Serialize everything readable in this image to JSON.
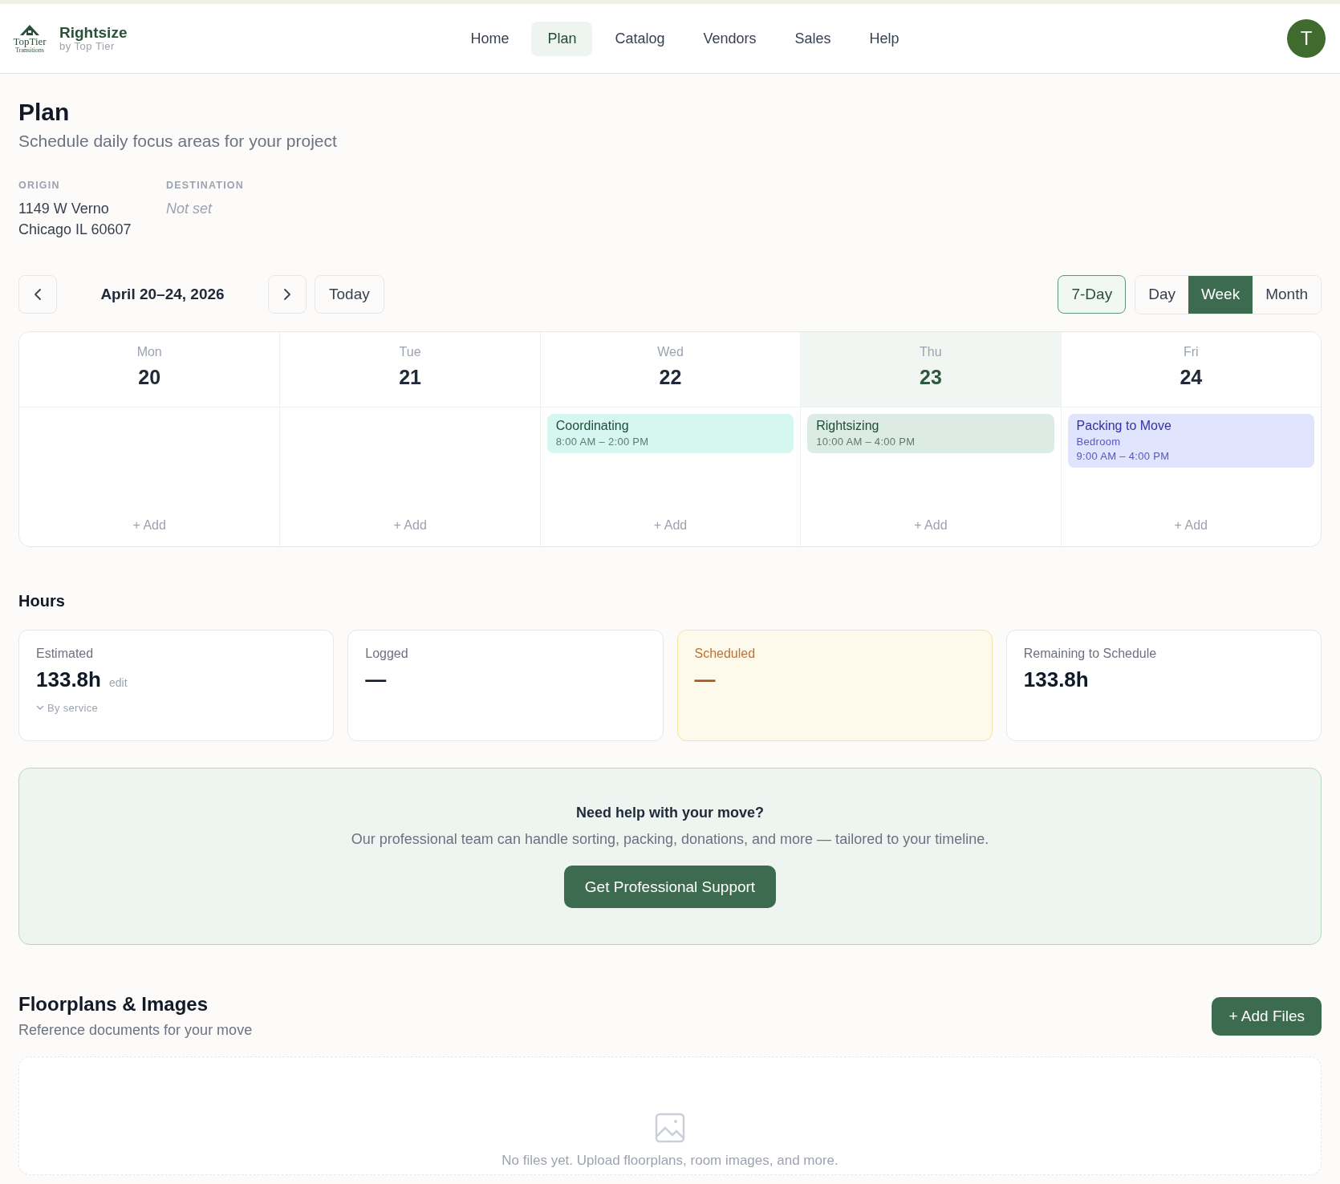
{
  "brand": {
    "logo_lines": [
      "TopTier",
      "Transitions"
    ],
    "name": "Rightsize",
    "tagline": "by Top Tier"
  },
  "nav": [
    {
      "label": "Home",
      "selected": false
    },
    {
      "label": "Plan",
      "selected": true
    },
    {
      "label": "Catalog",
      "selected": false
    },
    {
      "label": "Vendors",
      "selected": false
    },
    {
      "label": "Sales",
      "selected": false
    },
    {
      "label": "Help",
      "selected": false
    }
  ],
  "avatar": {
    "initial": "T"
  },
  "page": {
    "title": "Plan",
    "subtitle": "Schedule daily focus areas for your project"
  },
  "locations": [
    {
      "label": "ORIGIN",
      "lines": [
        "1149 W Verno",
        "Chicago IL 60607"
      ],
      "set": true
    },
    {
      "label": "DESTINATION",
      "lines": [
        "Not set"
      ],
      "set": false
    }
  ],
  "toolbar": {
    "range": "April 20–24, 2026",
    "today": "Today",
    "seven_day": {
      "label": "7-Day",
      "active": true
    },
    "views": [
      {
        "label": "Day",
        "selected": false
      },
      {
        "label": "Week",
        "selected": true
      },
      {
        "label": "Month",
        "selected": false
      }
    ]
  },
  "calendar": {
    "days": [
      {
        "weekday": "Mon",
        "date": "20",
        "today": false,
        "add_label": "+ Add"
      },
      {
        "weekday": "Tue",
        "date": "21",
        "today": false,
        "add_label": "+ Add"
      },
      {
        "weekday": "Wed",
        "date": "22",
        "today": false,
        "add_label": "+ Add",
        "events": [
          {
            "title": "Coordinating",
            "time": "8:00 AM – 2:00 PM",
            "color": "#d5f7ef"
          }
        ]
      },
      {
        "weekday": "Thu",
        "date": "23",
        "today": true,
        "add_label": "+ Add",
        "events": [
          {
            "title": "Rightsizing",
            "time": "10:00 AM – 4:00 PM",
            "color": "#dcebe3"
          }
        ]
      },
      {
        "weekday": "Fri",
        "date": "24",
        "today": false,
        "add_label": "+ Add",
        "events": [
          {
            "title": "Packing to Move",
            "room": "Bedroom",
            "time": "9:00 AM – 4:00 PM",
            "color": "#e0e4fc"
          }
        ]
      }
    ]
  },
  "hours": {
    "title": "Hours",
    "cards": [
      {
        "kind": "estimated",
        "label": "Estimated",
        "value": "133.8h",
        "edit": "edit",
        "breakdown": "By service"
      },
      {
        "kind": "logged",
        "label": "Logged",
        "value": "—"
      },
      {
        "kind": "scheduled",
        "label": "Scheduled",
        "value": "—"
      },
      {
        "kind": "remaining",
        "label": "Remaining to Schedule",
        "value": "133.8h"
      }
    ]
  },
  "help": {
    "title": "Need help with your move?",
    "text": "Our professional team can handle sorting, packing, donations, and more — tailored to your timeline.",
    "button": "Get Professional Support"
  },
  "files": {
    "title": "Floorplans & Images",
    "subtitle": "Reference documents for your move",
    "button": "+ Add Files",
    "empty": "No files yet. Upload floorplans, room images, and more."
  }
}
